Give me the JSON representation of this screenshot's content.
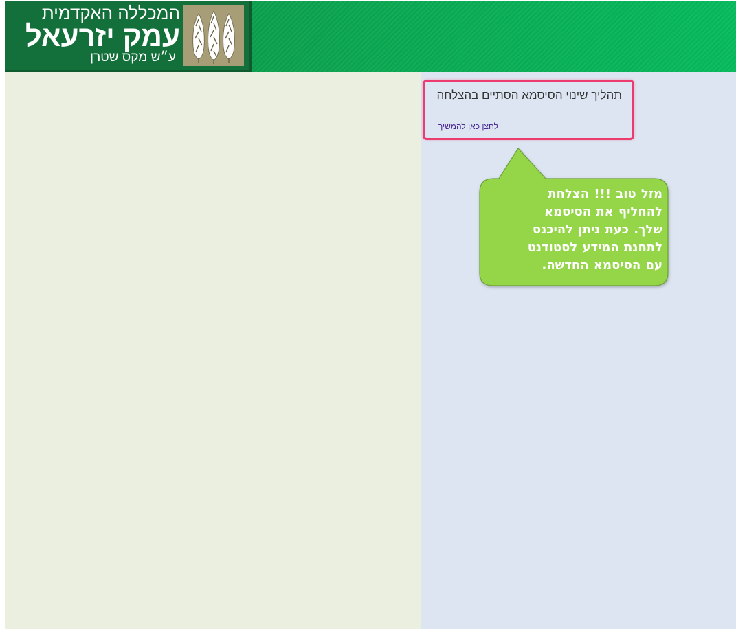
{
  "header": {
    "logo_line1": "המכללה האקדמית",
    "logo_line2": "עמק יזרעאל",
    "logo_line3": "ע״ש מקס שטרן",
    "brand_green": "#0c8a44",
    "emblem_color": "#a79e77"
  },
  "message": {
    "text": "תהליך שינוי הסיסמא הסתיים בהצלחה",
    "link": "לחצן כאן להמשיך",
    "highlight_color": "#ec3b6e"
  },
  "callout": {
    "lines": [
      "מזל טוב !!! הצלחת",
      "להחליף את הסיסמא",
      "שלך. כעת ניתן להיכנס",
      "לתחנת המידע לסטודנט",
      "עם הסיסמא החדשה."
    ],
    "bubble_color": "#95d64a"
  },
  "icons": {
    "emblem": "cypress-trees-icon",
    "callout": "speech-bubble"
  }
}
